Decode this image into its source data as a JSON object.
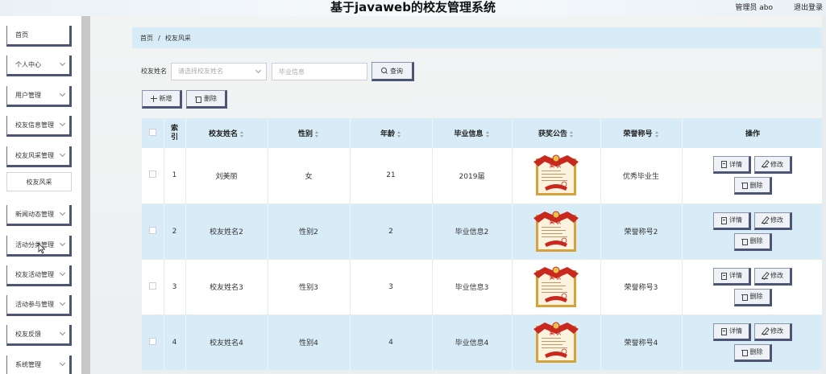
{
  "header": {
    "title": "基于javaweb的校友管理系统",
    "user": "管理员 abo",
    "logout": "退出登录"
  },
  "sidebar": {
    "items": [
      {
        "label": "首页",
        "has_arrow": false
      },
      {
        "label": "个人中心",
        "has_arrow": true
      },
      {
        "label": "用户管理",
        "has_arrow": true
      },
      {
        "label": "校友信息管理",
        "has_arrow": true
      },
      {
        "label": "校友风采管理",
        "has_arrow": true
      },
      {
        "label": "新闻动态管理",
        "has_arrow": true
      },
      {
        "label": "活动分类管理",
        "has_arrow": true
      },
      {
        "label": "校友活动管理",
        "has_arrow": true
      },
      {
        "label": "活动参与管理",
        "has_arrow": true
      },
      {
        "label": "校友反馈",
        "has_arrow": true
      },
      {
        "label": "系统管理",
        "has_arrow": true
      }
    ],
    "submenu": {
      "label": "校友风采"
    }
  },
  "breadcrumb": {
    "home": "首页",
    "separator": "/",
    "current": "校友风采"
  },
  "search": {
    "label": "校友姓名",
    "select_placeholder": "请选择校友姓名",
    "input_placeholder": "毕业信息",
    "button": "查询"
  },
  "actions": {
    "add": "新增",
    "delete": "删除"
  },
  "table": {
    "columns": [
      "索引",
      "校友姓名",
      "性别",
      "年龄",
      "毕业信息",
      "获奖公告",
      "荣誉称号",
      "操作"
    ],
    "rows": [
      {
        "index": "1",
        "name": "刘美丽",
        "gender": "女",
        "age": "21",
        "grad": "2019届",
        "title": "优秀毕业生"
      },
      {
        "index": "2",
        "name": "校友姓名2",
        "gender": "性别2",
        "age": "2",
        "grad": "毕业信息2",
        "title": "荣誉称号2"
      },
      {
        "index": "3",
        "name": "校友姓名3",
        "gender": "性别3",
        "age": "3",
        "grad": "毕业信息3",
        "title": "荣誉称号3"
      },
      {
        "index": "4",
        "name": "校友姓名4",
        "gender": "性别4",
        "age": "4",
        "grad": "毕业信息4",
        "title": "荣誉称号4"
      }
    ],
    "row_buttons": {
      "detail": "详情",
      "edit": "修改",
      "delete": "删除"
    },
    "certificate_text": "奖状"
  },
  "colors": {
    "header_blue": "#d7ecf7",
    "button_border": "#4d5574",
    "certificate_red": "#c8281e",
    "certificate_gold": "#d8a23a"
  }
}
